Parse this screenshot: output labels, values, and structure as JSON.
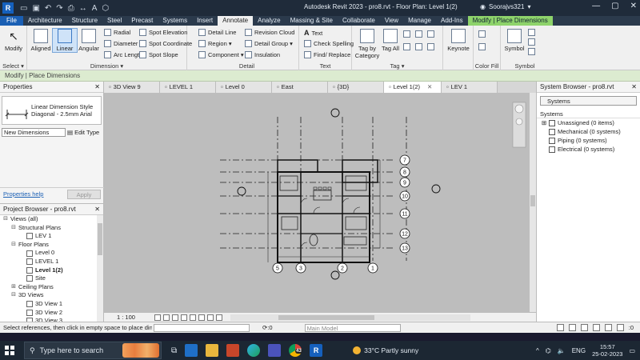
{
  "titlebar": {
    "logo": "R",
    "title": "Autodesk Revit 2023 - pro8.rvt - Floor Plan: Level 1(2)",
    "user": "Soorajvs321",
    "qat_icons": [
      "open-icon",
      "save-icon",
      "undo-icon",
      "redo-icon",
      "print-icon",
      "measure-icon",
      "text-icon",
      "3d-icon"
    ]
  },
  "tabs": [
    "File",
    "Architecture",
    "Structure",
    "Steel",
    "Precast",
    "Systems",
    "Insert",
    "Annotate",
    "Analyze",
    "Massing & Site",
    "Collaborate",
    "View",
    "Manage",
    "Add-Ins",
    "Modify | Place Dimensions"
  ],
  "active_tab": "Annotate",
  "ribbon": {
    "select_panel": {
      "label": "Select ▾",
      "modify": "Modify"
    },
    "dimension_panel": {
      "label": "Dimension ▾",
      "aligned": "Aligned",
      "linear": "Linear",
      "angular": "Angular",
      "radial": "Radial",
      "diameter": "Diameter",
      "arc_length": "Arc Length",
      "spot_elevation": "Spot Elevation",
      "spot_coordinate": "Spot Coordinate",
      "spot_slope": "Spot Slope"
    },
    "detail_panel": {
      "label": "Detail",
      "detail_line": "Detail Line",
      "region": "Region ▾",
      "component": "Component ▾",
      "revision_cloud": "Revision Cloud",
      "detail_group": "Detail Group ▾",
      "insulation": "Insulation"
    },
    "text_panel": {
      "label": "Text",
      "text": "Text",
      "check_spelling": "Check Spelling",
      "find_replace": "Find/ Replace"
    },
    "tag_panel": {
      "label": "Tag ▾",
      "tag_by_category": "Tag by Category",
      "tag_all": "Tag All"
    },
    "keynote": "Keynote",
    "color_fill_panel": {
      "label": "Color Fill"
    },
    "symbol_panel": {
      "label": "Symbol",
      "symbol": "Symbol"
    }
  },
  "modify_bar": "Modify | Place Dimensions",
  "properties": {
    "title": "Properties",
    "type_name_line1": "Linear Dimension Style",
    "type_name_line2": "Diagonal - 2.5mm Arial",
    "instance_filter": "New Dimensions",
    "edit_type": "Edit Type",
    "help_link": "Properties help",
    "apply": "Apply"
  },
  "project_browser": {
    "title": "Project Browser - pro8.rvt",
    "nodes": [
      {
        "label": "Views (all)",
        "level": 0,
        "toggle": "⊟"
      },
      {
        "label": "Structural Plans",
        "level": 1,
        "toggle": "⊟"
      },
      {
        "label": "LEV 1",
        "level": 2,
        "toggle": ""
      },
      {
        "label": "Floor Plans",
        "level": 1,
        "toggle": "⊟"
      },
      {
        "label": "Level 0",
        "level": 2,
        "toggle": ""
      },
      {
        "label": "LEVEL 1",
        "level": 2,
        "toggle": ""
      },
      {
        "label": "Level 1(2)",
        "level": 2,
        "toggle": "",
        "bold": true
      },
      {
        "label": "Site",
        "level": 2,
        "toggle": ""
      },
      {
        "label": "Ceiling Plans",
        "level": 1,
        "toggle": "⊞"
      },
      {
        "label": "3D Views",
        "level": 1,
        "toggle": "⊟"
      },
      {
        "label": "3D View 1",
        "level": 2,
        "toggle": ""
      },
      {
        "label": "3D View 2",
        "level": 2,
        "toggle": ""
      },
      {
        "label": "3D View 3",
        "level": 2,
        "toggle": ""
      }
    ]
  },
  "view_tabs": [
    {
      "label": "3D View 9",
      "active": false
    },
    {
      "label": "LEVEL 1",
      "active": false
    },
    {
      "label": "Level 0",
      "active": false
    },
    {
      "label": "East",
      "active": false
    },
    {
      "label": "{3D}",
      "active": false
    },
    {
      "label": "Level 1(2)",
      "active": true
    },
    {
      "label": "LEV 1",
      "active": false
    }
  ],
  "grid_bubbles_right": [
    "7",
    "8",
    "9",
    "10",
    "11",
    "12",
    "13"
  ],
  "grid_bubbles_bottom": [
    "5",
    "3",
    "2",
    "1"
  ],
  "view_control": {
    "scale": "1 : 100"
  },
  "system_browser": {
    "title": "System Browser - pro8.rvt",
    "filter": "Systems",
    "header": "Systems",
    "nodes": [
      {
        "label": "Unassigned (0 items)",
        "toggle": "⊞"
      },
      {
        "label": "Mechanical (0 systems)",
        "toggle": ""
      },
      {
        "label": "Piping (0 systems)",
        "toggle": ""
      },
      {
        "label": "Electrical (0 systems)",
        "toggle": ""
      }
    ]
  },
  "status_bar": {
    "message": "Select references, then click in empty space to place din",
    "zero": ":0",
    "model": "Main Model",
    "filter_count": ":0"
  },
  "taskbar": {
    "search_placeholder": "Type here to search",
    "weather": "33°C  Partly sunny",
    "lang": "ENG",
    "time": "15:57",
    "date": "25-02-2023",
    "badge": "43"
  }
}
